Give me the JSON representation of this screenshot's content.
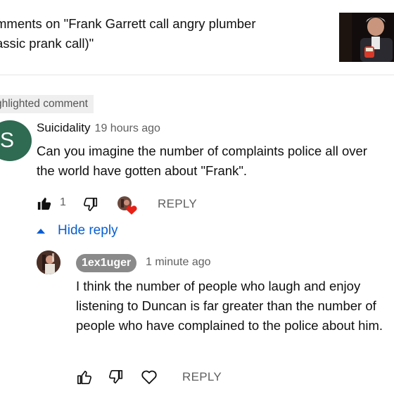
{
  "header": {
    "title": "mments on \"Frank Garrett call angry plumber (Classic prank call)\"",
    "title_line1": "mments on \"Frank Garrett call angry plumber",
    "title_line2": "assic prank call)\""
  },
  "highlighted_label": "ghlighted comment",
  "comment": {
    "avatar_letter": "S",
    "author": "Suicidality",
    "time": "19 hours ago",
    "text": "Can you imagine the number of complaints police all over the world have gotten about \"Frank\".",
    "likes": "1",
    "reply_label": "REPLY",
    "hide_reply_label": "Hide reply"
  },
  "reply": {
    "author": "1ex1uger",
    "time": "1 minute ago",
    "text": "I think the number of people who laugh and enjoy listening to Duncan is far greater than the number of people who have complained to the police about him.",
    "reply_label": "REPLY"
  },
  "colors": {
    "link_blue": "#065fd4",
    "avatar_green": "#2f6a52",
    "heart_red": "#e62117",
    "secondary_text": "#606060"
  },
  "icons": [
    "thumbs-up-filled-icon",
    "thumbs-down-icon",
    "creator-heart-icon",
    "thumbs-up-icon",
    "heart-icon",
    "caret-up-icon"
  ]
}
